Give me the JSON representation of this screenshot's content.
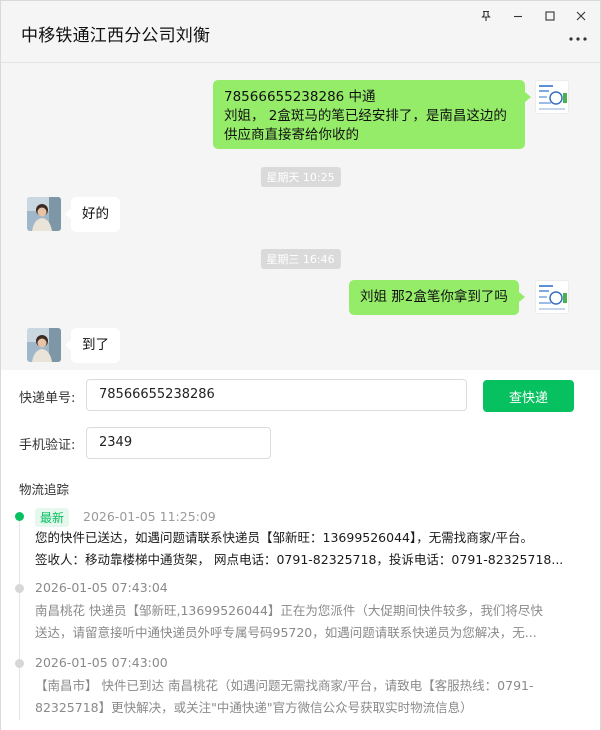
{
  "window": {
    "title": "中移铁通江西分公司刘衡",
    "pin_icon": "pin-icon",
    "minimize_icon": "minimize-icon",
    "maximize_icon": "maximize-icon",
    "close_icon": "close-icon",
    "more_icon": "more-options-icon"
  },
  "chat": {
    "messages": [
      {
        "sender": "me",
        "text": "78566655238286   中通\n刘姐，  2盒斑马的笔已经安排了，是南昌这边的\n供应商直接寄给你收的"
      },
      {
        "type": "time",
        "text": "星期天 10:25"
      },
      {
        "sender": "other",
        "text": "好的"
      },
      {
        "type": "time",
        "text": "星期三 16:46"
      },
      {
        "sender": "me",
        "text": "刘姐  那2盒笔你拿到了吗"
      },
      {
        "sender": "other",
        "text": "到了"
      }
    ]
  },
  "express": {
    "tracking_label": "快递单号:",
    "tracking_value": "78566655238286",
    "query_button": "查快递",
    "phone_label": "手机验证:",
    "phone_value": "2349",
    "section_title": "物流追踪",
    "events": [
      {
        "badge": "最新",
        "time": "2026-01-05 11:25:09",
        "line1": "您的快件已送达，如遇问题请联系快递员【邹新旺：13699526044】，无需找商家/平台。",
        "line2": "签收人：移动靠楼梯中通货架， 网点电话：0791-82325718，投诉电话：0791-82325718..."
      },
      {
        "time": "2026-01-05 07:43:04",
        "line1": "南昌桃花 快递员【邹新旺,13699526044】正在为您派件（大促期间快件较多，我们将尽快",
        "line2": "送达，请留意接听中通快递员外呼专属号码95720，如遇问题请联系快递员为您解决，无..."
      },
      {
        "time": "2026-01-05 07:43:00",
        "line1": "【南昌市】 快件已到达 南昌桃花（如遇问题无需找商家/平台，请致电【客服热线：0791-",
        "line2": "82325718】更快解决，或关注\"中通快递\"官方微信公众号获取实时物流信息）"
      }
    ]
  },
  "colors": {
    "accent": "#07c160",
    "bubble_me": "#95ec69",
    "chat_bg": "#f5f5f5"
  }
}
